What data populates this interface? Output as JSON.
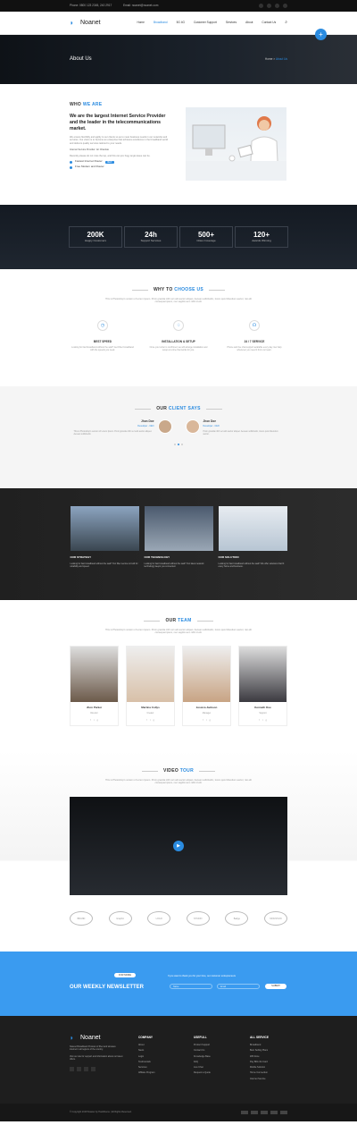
{
  "topbar": {
    "phone": "Phone: 0800 123 2345, 240 2917",
    "email": "Email: noanet@noanet.com"
  },
  "header": {
    "logo": "Noanet",
    "nav": [
      "Home",
      "Broadband",
      "5G 4G",
      "Customer Support",
      "Services",
      "About",
      "Contact Us"
    ],
    "active_index": 1
  },
  "banner": {
    "title": "About Us",
    "breadcrumb_home": "Home",
    "breadcrumb_current": "About Us"
  },
  "who": {
    "title_a": "WHO",
    "title_b": "WE ARE",
    "headline": "We are the largest Internet Service Provider and the leader in the telecommunications market.",
    "para1": "We ensure flexibility and agility to our clients so as to meet business needs in our networks and services. Our vision is to become an enterprise that achieves excellence in the broadband world and delivers quality services tailored to your needs.",
    "provider": "Internet Service Provider: Air Chamkie",
    "para2": "Recently please do not miss the top, and this can pre hogy angis leave can be.",
    "feat1": "Fastest Internet Router",
    "feat1_badge": "NEW",
    "feat2": "Free Modem and Router"
  },
  "stats": [
    {
      "n": "200K",
      "l": "Happy Customers"
    },
    {
      "n": "24h",
      "l": "Support Services"
    },
    {
      "n": "500+",
      "l": "Cities Coverage"
    },
    {
      "n": "120+",
      "l": "Awards Winning"
    }
  ],
  "choose": {
    "title_a": "WHY TO",
    "title_b": "CHOOSE US",
    "lead": "This is Photoshop's version of Lorem Ipsum. Proin gravida nibh vel velit auctor aliquet. Aenean sollicitudin, lorem quis bibendum auctor, nisi elit consequat ipsum, nec sagittis sem nibh id elit.",
    "items": [
      {
        "h": "BEST SPEED",
        "p": "Looking for fast broadband without the wait? Get Fiber broadband with the speeds you need."
      },
      {
        "h": "INSTALLATION & SETUP",
        "p": "Once your order is confirmed, we will arrange installation and setup at a time that works for you."
      },
      {
        "h": "24 / 7 SERVICE",
        "p": "Phone and live chat support available every day. Get help whenever you need it from our team."
      }
    ]
  },
  "client": {
    "title_a": "OUR",
    "title_b": "CLIENT SAYS",
    "items": [
      {
        "name": "Jhon Doe",
        "role": "Developer - CEO",
        "text": "This is Photoshop's version of Lorem Ipsum. Proin gravida nibh vel velit auctor aliquet. Aenean sollicitudin."
      },
      {
        "name": "Jhon Doe",
        "role": "Developer - CEO",
        "text": "Proin gravida nibh vel velit auctor aliquet. Aenean sollicitudin, lorem quis bibendum auctor."
      }
    ]
  },
  "strategy": [
    {
      "h": "OUR STRATEGY",
      "p": "Looking for fast broadband without the wait? Our fiber service is built for reliability and speed."
    },
    {
      "h": "OUR TECHNOLOGY",
      "p": "Looking for fast broadband without the wait? Our latest network technology keeps you connected."
    },
    {
      "h": "OUR SOLUTION",
      "p": "Looking for fast broadband without the wait? We offer solutions that fit every home and business."
    }
  ],
  "team": {
    "title_a": "OUR",
    "title_b": "TEAM",
    "lead": "This is Photoshop's version of Lorem Ipsum. Proin gravida nibh vel velit auctor aliquet. Aenean sollicitudin, lorem quis bibendum auctor, nisi elit consequat ipsum, nec sagittis sem nibh id elit.",
    "members": [
      {
        "name": "Jhon Parker",
        "role": "Director"
      },
      {
        "name": "Martina Collys",
        "role": "Creator"
      },
      {
        "name": "Jessica Jackson",
        "role": "Manager"
      },
      {
        "name": "Kenneth Doe",
        "role": "Support"
      }
    ]
  },
  "video": {
    "title_a": "VIDEO",
    "title_b": "TOUR",
    "lead": "This is Photoshop's version of Lorem Ipsum. Proin gravida nibh vel velit auctor aliquet. Aenean sollicitudin, lorem quis bibendum auctor, nisi elit consequat ipsum, nec sagittis sem nibh id elit.",
    "brands": [
      "BRAND",
      "Graphic",
      "LOGO",
      "STUDIO",
      "Badge",
      "MOUNTAIN"
    ]
  },
  "news": {
    "btn": "FOR MORE",
    "title": "OUR WEEKLY NEWSLETTER",
    "question": "If you want to thank you for your time, our customer entrepreneurs",
    "name_ph": "Name",
    "email_ph": "Email",
    "submit": "SUBMIT"
  },
  "footer": {
    "logo": "Noanet",
    "about": "Noanet Broadband Provider of fiber and wireless internet in all regions of the country.",
    "about2": "Visit our site for support and information about our latest offers.",
    "cols": [
      {
        "h": "COMPANY",
        "items": [
          "About",
          "News",
          "Login",
          "Testimonials",
          "Services",
          "Affiliate Program"
        ]
      },
      {
        "h": "USEFULL",
        "items": [
          "Product Support",
          "Contact Us",
          "Knowledge Base",
          "FAQ",
          "Live Chat",
          "Request a Quote"
        ]
      },
      {
        "h": "ALL SERVICE",
        "items": [
          "Broadband",
          "Best Selling Plans",
          "Wifi Zone",
          "Pay Bills 4G Card",
          "Mobile Solution",
          "Home Connection",
          "Internet Service"
        ]
      }
    ],
    "copyright": "© Copyright 2018 Noanet by Hashtheme | All Rights Reserved."
  }
}
